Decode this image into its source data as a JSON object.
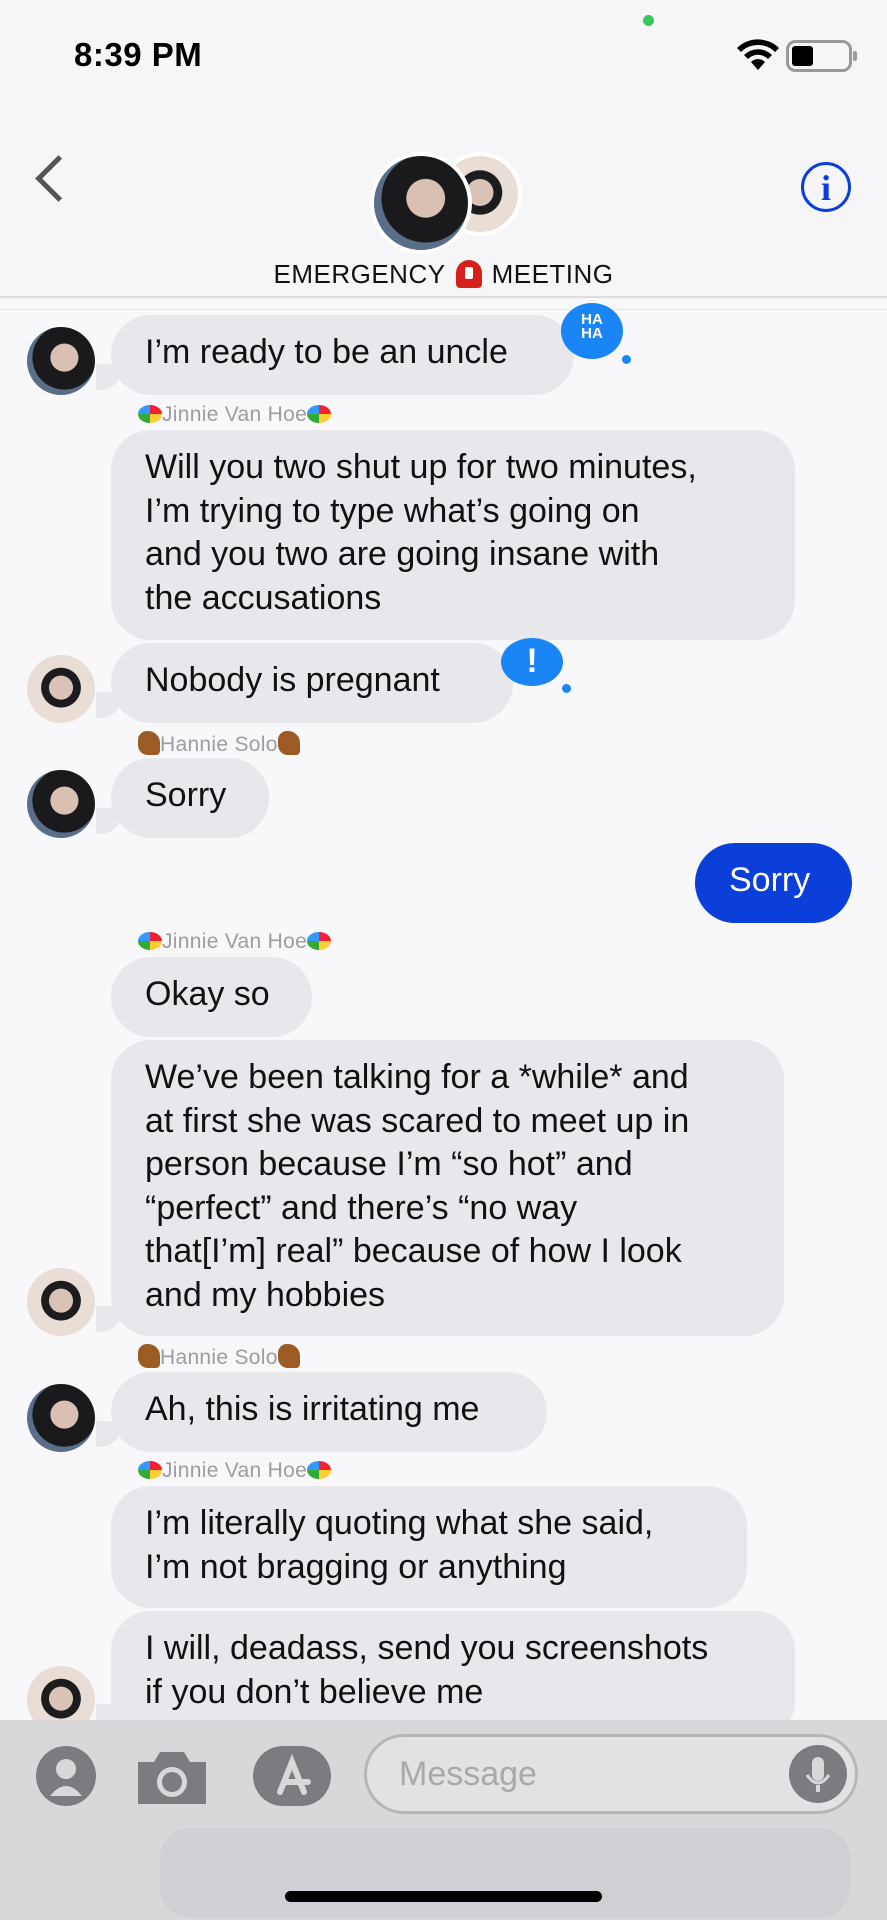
{
  "status_bar": {
    "time": "8:39 PM"
  },
  "header": {
    "group_name_left": "EMERGENCY",
    "group_name_right": "MEETING"
  },
  "messages": {
    "m1": "I’m ready to be an uncle",
    "sender_jinnie_1": "Jinnie Van Hoe",
    "m2": [
      "Will you two shut up for two minutes,",
      "I’m trying to type what’s going on",
      "and you two are going insane with",
      "the accusations"
    ],
    "m3": "Nobody is pregnant",
    "sender_hannie_1": "Hannie Solo",
    "m4": "Sorry",
    "m5_me": "Sorry",
    "sender_jinnie_2": "Jinnie Van Hoe",
    "m6": "Okay so",
    "m7": [
      "We’ve been talking for a *while* and",
      "at first she was scared to meet up in",
      "person because I’m “so hot” and",
      "“perfect” and there’s “no way",
      "that[I’m] real” because of how I look",
      "and my hobbies"
    ],
    "sender_hannie_2": "Hannie Solo",
    "m8": "Ah, this is irritating me",
    "sender_jinnie_3": "Jinnie Van Hoe",
    "m9": [
      "I’m literally quoting what she said,",
      "I’m not bragging or anything"
    ],
    "m10": [
      "I will, deadass, send you screenshots",
      "if you don’t believe me"
    ]
  },
  "reactions": {
    "haha": "HA\nHA",
    "exclaim": "!"
  },
  "composer": {
    "placeholder": "Message"
  },
  "colors": {
    "my_bubble": "#0a3fd9",
    "their_bubble": "#e8e7ec",
    "reaction": "#1a86f5"
  }
}
